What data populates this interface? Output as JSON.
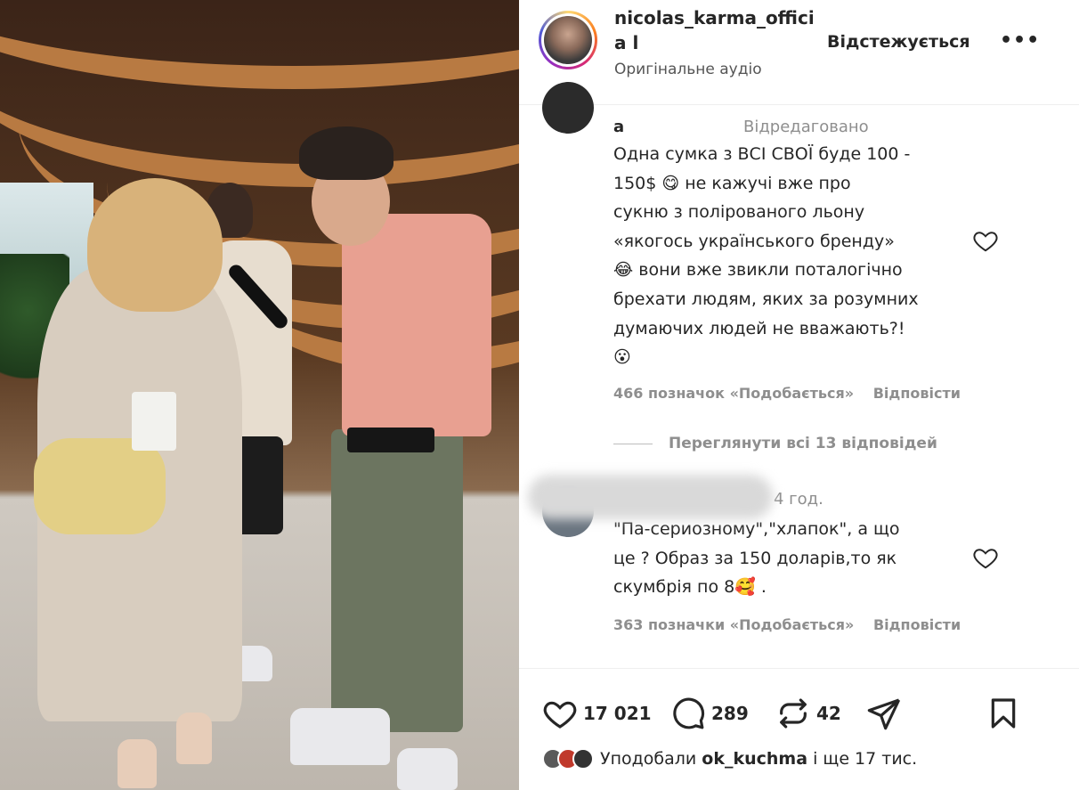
{
  "post": {
    "username": "nicolas_karma_officia l",
    "follow_status": "Відстежується",
    "more_label": "•••",
    "audio": "Оригінальне аудіо"
  },
  "comments": [
    {
      "name": "a",
      "meta": "Відредаговано",
      "lines": [
        "Одна сумка з ВСІ СВОЇ буде 100 -",
        "150$ 😋 не кажучі вже про",
        "сукню з полірованого льону",
        "«якогось українського бренду»",
        "😂 вони вже звикли поталогічно",
        "брехати людям, яких за розумних",
        "думаючих людей не вважають?!",
        "😮"
      ],
      "likes": "466 позначок «Подобається»",
      "reply": "Відповісти"
    },
    {
      "name": "",
      "meta": "4 год.",
      "lines": [
        "\"Па-сериозному\",\"хлапок\", а що",
        "це ? Образ за 150 доларів,то як",
        "скумбрія по 8🥰 ."
      ],
      "likes": "363 позначки «Подобається»",
      "reply": "Відповісти"
    }
  ],
  "view_replies": "Переглянути всі 13 відповідей",
  "stats": {
    "likes": "17 021",
    "comments": "289",
    "reposts": "42"
  },
  "liked_by": {
    "prefix": "Уподобали",
    "user": "ok_kuchma",
    "suffix": "і ще 17 тис."
  },
  "colors": {
    "text": "#262626",
    "muted": "#8e8e8e",
    "shirt": "#e8a091"
  }
}
